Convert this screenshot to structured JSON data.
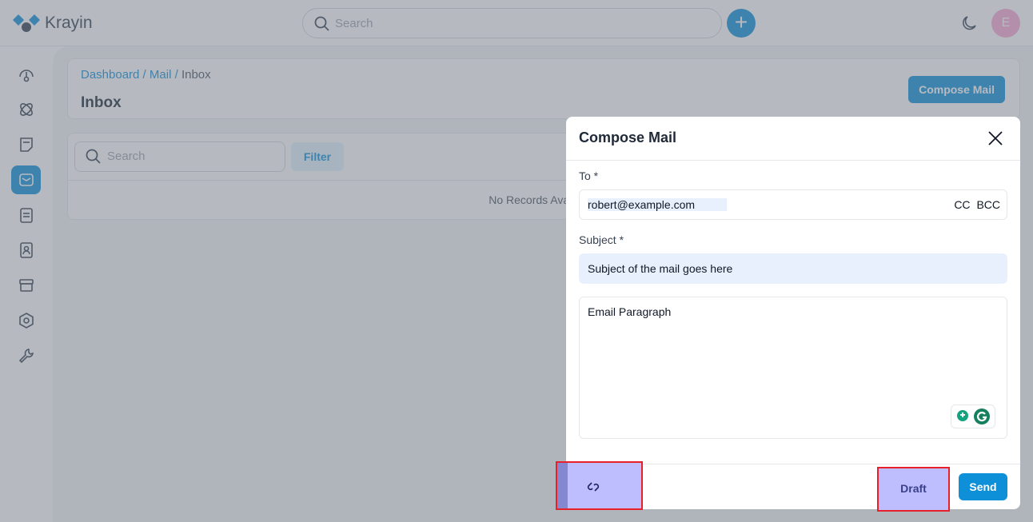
{
  "app": {
    "name": "Krayin",
    "search_placeholder": "Search",
    "avatar_initial": "E"
  },
  "sidebar": {
    "items": [
      {
        "icon": "dashboard-icon"
      },
      {
        "icon": "leads-icon"
      },
      {
        "icon": "quotes-icon"
      },
      {
        "icon": "mail-icon",
        "active": true
      },
      {
        "icon": "activities-icon"
      },
      {
        "icon": "contacts-icon"
      },
      {
        "icon": "products-icon"
      },
      {
        "icon": "settings-icon"
      },
      {
        "icon": "configuration-icon"
      }
    ]
  },
  "page": {
    "breadcrumb": [
      "Dashboard",
      "Mail",
      "Inbox"
    ],
    "title": "Inbox",
    "compose_label": "Compose Mail",
    "search_placeholder": "Search",
    "filter_label": "Filter",
    "empty_text": "No Records Available."
  },
  "modal": {
    "title": "Compose Mail",
    "to_label": "To *",
    "to_value": "robert@example.com",
    "cc_label": "CC",
    "bcc_label": "BCC",
    "subject_label": "Subject *",
    "subject_value": "Subject of the mail goes here",
    "body_placeholder": "Email Paragraph",
    "draft_label": "Draft",
    "send_label": "Send"
  },
  "colors": {
    "accent": "#0e90d9",
    "highlight": "#e8202a"
  }
}
